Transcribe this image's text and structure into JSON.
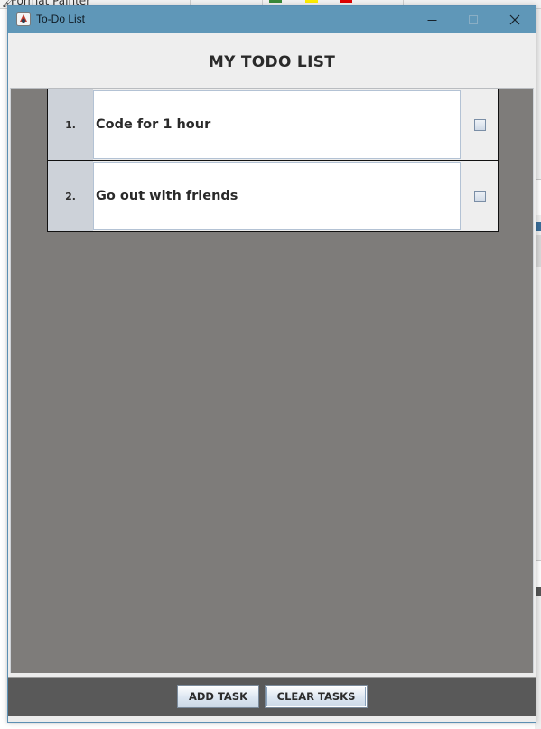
{
  "background_app": {
    "ribbon_item": "Format Painter",
    "swatch_colors": [
      "#ffee00",
      "#e00000"
    ]
  },
  "window": {
    "title": "To-Do List",
    "controls": {
      "minimize": "─",
      "maximize": "□",
      "close": "✕"
    }
  },
  "header": {
    "title": "MY TODO LIST"
  },
  "tasks": [
    {
      "number": "1.",
      "text": "Code for 1 hour",
      "done": false
    },
    {
      "number": "2.",
      "text": "Go out with friends",
      "done": false
    }
  ],
  "buttons": {
    "add_label": "ADD TASK",
    "clear_label": "CLEAR TASKS"
  },
  "colors": {
    "titlebar": "#5f97b8",
    "list_background": "#7e7c7a",
    "button_bar": "#595959",
    "number_cell": "#cdd2d9"
  }
}
